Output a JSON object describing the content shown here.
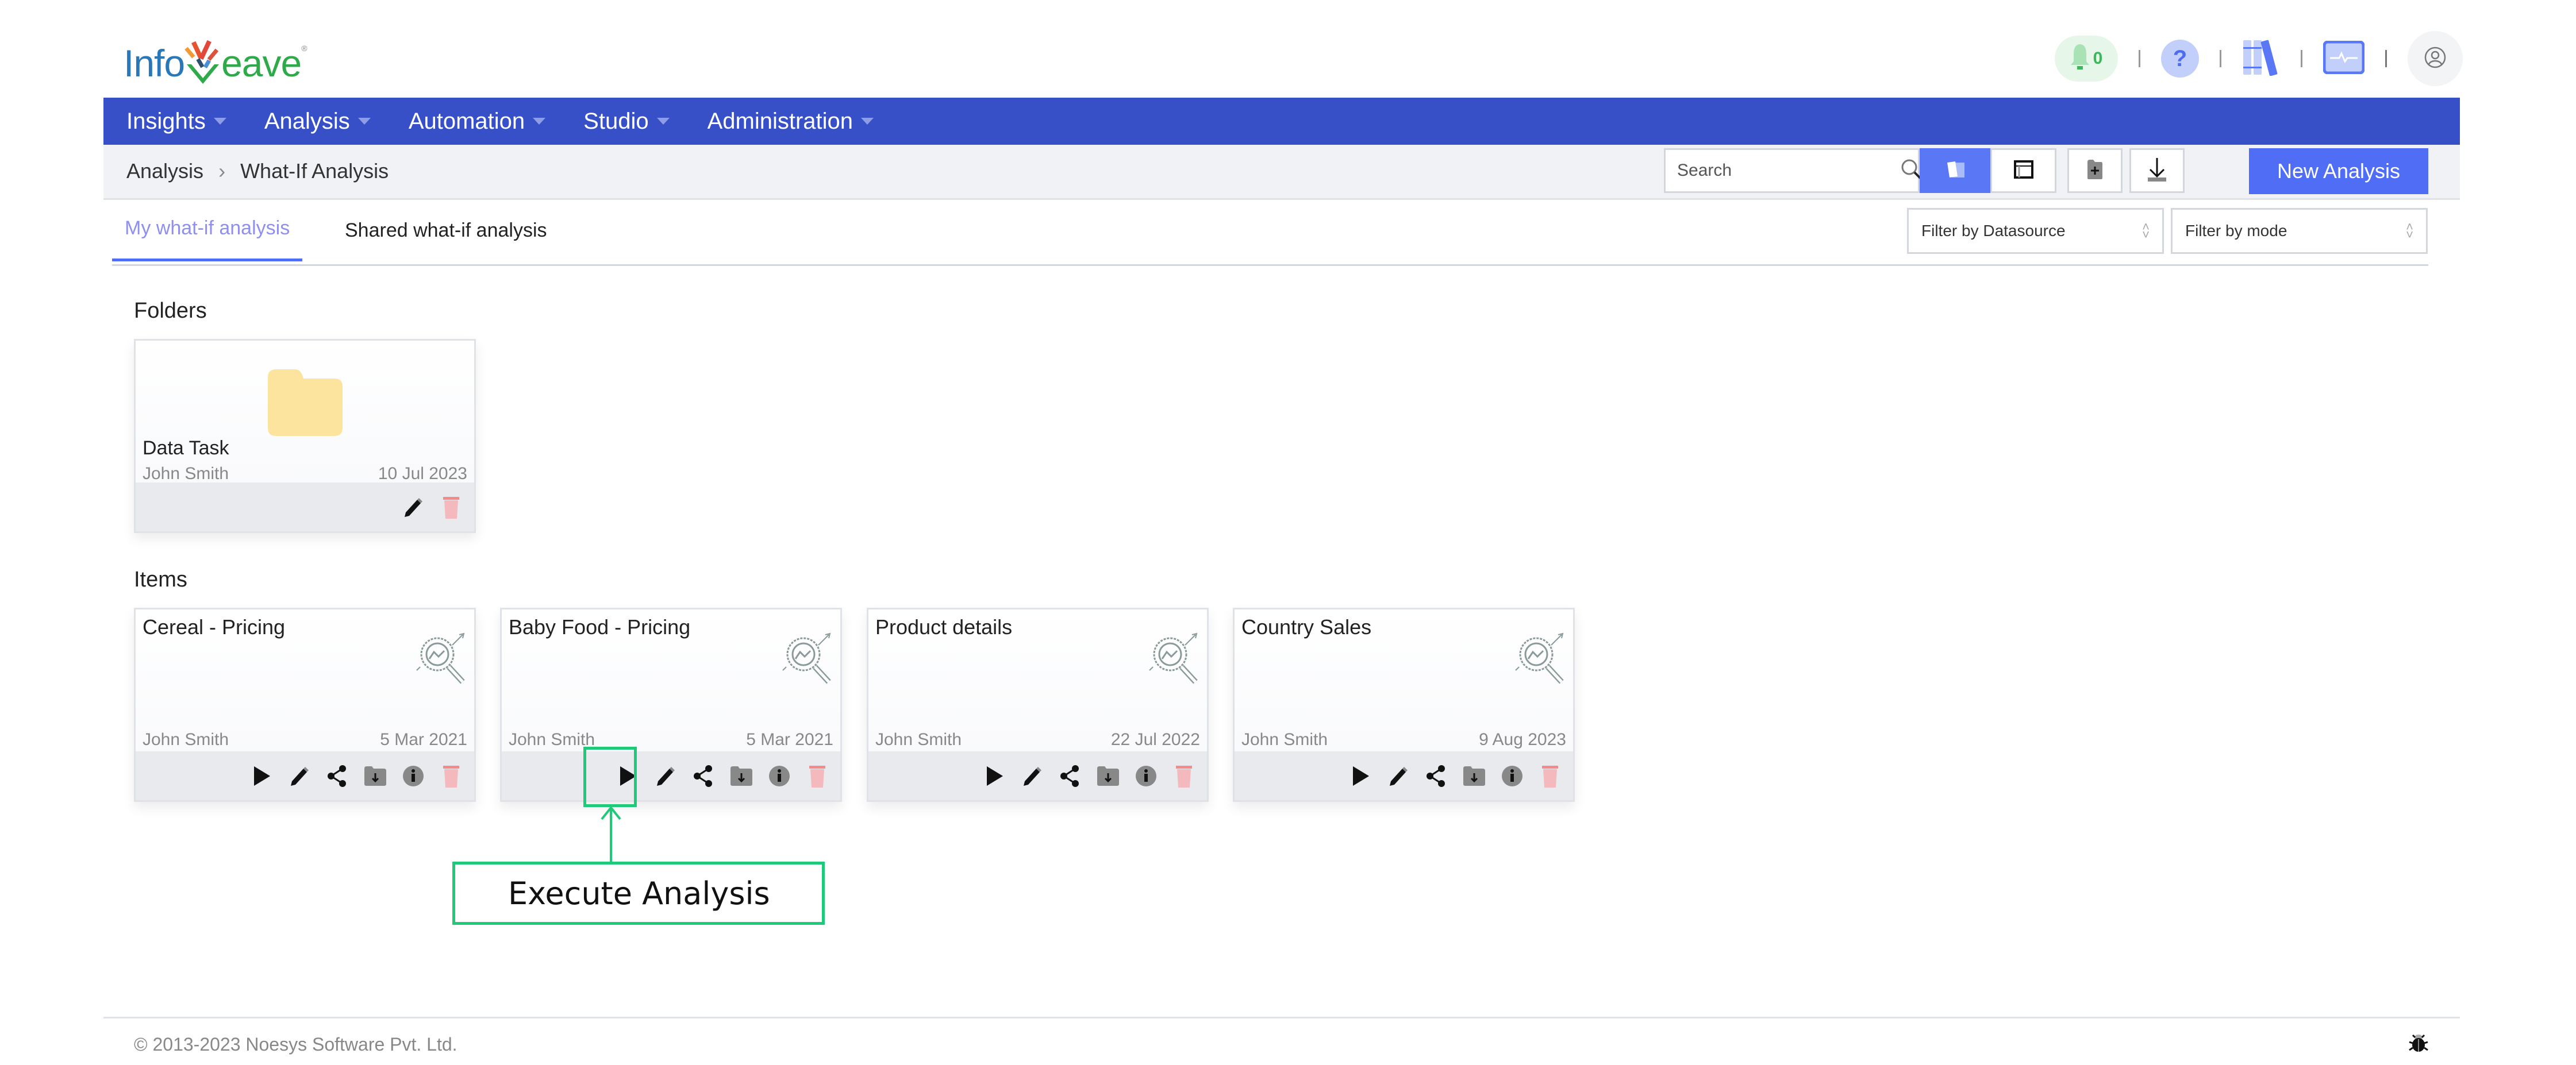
{
  "header": {
    "logo": {
      "part1": "Info",
      "part2": "eave",
      "registered": "®"
    },
    "notifications": {
      "count": "0"
    },
    "help_label": "?"
  },
  "nav": {
    "items": [
      {
        "label": "Insights"
      },
      {
        "label": "Analysis"
      },
      {
        "label": "Automation"
      },
      {
        "label": "Studio"
      },
      {
        "label": "Administration"
      }
    ]
  },
  "breadcrumb": {
    "items": [
      "Analysis",
      "What-If Analysis"
    ],
    "separator": "›"
  },
  "toolbar": {
    "search_placeholder": "Search",
    "new_button_label": "New Analysis"
  },
  "tabs": [
    {
      "label": "My what-if analysis",
      "active": true
    },
    {
      "label": "Shared what-if analysis",
      "active": false
    }
  ],
  "filters": [
    {
      "placeholder": "Filter by Datasource"
    },
    {
      "placeholder": "Filter by mode"
    }
  ],
  "sections": {
    "folders_title": "Folders",
    "items_title": "Items"
  },
  "folders": [
    {
      "name": "Data Task",
      "owner": "John Smith",
      "date": "10 Jul 2023"
    }
  ],
  "items": [
    {
      "name": "Cereal - Pricing",
      "owner": "John Smith",
      "date": "5 Mar 2021"
    },
    {
      "name": "Baby Food - Pricing",
      "owner": "John Smith",
      "date": "5 Mar 2021"
    },
    {
      "name": "Product details",
      "owner": "John Smith",
      "date": "22 Jul 2022"
    },
    {
      "name": "Country Sales",
      "owner": "John Smith",
      "date": "9 Aug 2023"
    }
  ],
  "callout": {
    "label": "Execute Analysis"
  },
  "footer": {
    "copyright": "© 2013-2023 Noesys Software Pvt. Ltd."
  },
  "colors": {
    "nav_bg": "#3750c8",
    "accent": "#4f6df5",
    "callout": "#1fc97a",
    "delete": "#f4b9bd",
    "folder": "#fde49e"
  }
}
